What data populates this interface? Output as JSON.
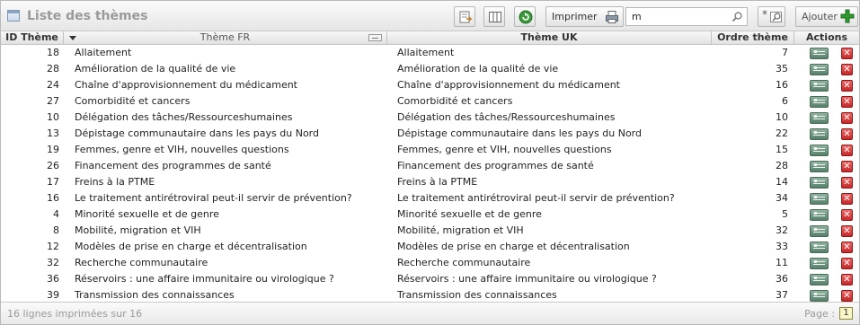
{
  "window": {
    "title": "Liste des thèmes"
  },
  "toolbar": {
    "print_label": "Imprimer",
    "search_value": "m",
    "search_placeholder": "",
    "clear_search_label": "*",
    "add_label": "Ajouter"
  },
  "columns": {
    "id": "ID Thème",
    "fr": "Thème FR",
    "uk": "Thème UK",
    "order": "Ordre thème",
    "actions": "Actions"
  },
  "rows": [
    {
      "id": "18",
      "fr": "Allaitement",
      "uk": "Allaitement",
      "order": "7"
    },
    {
      "id": "28",
      "fr": "Amélioration de la qualité de vie",
      "uk": "Amélioration de la qualité de vie",
      "order": "35"
    },
    {
      "id": "24",
      "fr": "Chaîne d'approvisionnement du médicament",
      "uk": "Chaîne d'approvisionnement du médicament",
      "order": "16"
    },
    {
      "id": "27",
      "fr": "Comorbidité et cancers",
      "uk": "Comorbidité et cancers",
      "order": "6"
    },
    {
      "id": "10",
      "fr": "Délégation des tâches/Ressourceshumaines",
      "uk": "Délégation des tâches/Ressourceshumaines",
      "order": "10"
    },
    {
      "id": "13",
      "fr": "Dépistage communautaire dans les pays du Nord",
      "uk": "Dépistage communautaire dans les pays du Nord",
      "order": "22"
    },
    {
      "id": "19",
      "fr": "Femmes, genre et VIH, nouvelles questions",
      "uk": "Femmes, genre et VIH, nouvelles questions",
      "order": "15"
    },
    {
      "id": "26",
      "fr": "Financement des programmes de santé",
      "uk": "Financement des programmes de santé",
      "order": "28"
    },
    {
      "id": "17",
      "fr": "Freins à la PTME",
      "uk": "Freins à la PTME",
      "order": "14"
    },
    {
      "id": "16",
      "fr": "Le traitement antirétroviral peut-il servir de prévention?",
      "uk": "Le traitement antirétroviral peut-il servir de prévention?",
      "order": "34"
    },
    {
      "id": "4",
      "fr": "Minorité sexuelle et de genre",
      "uk": "Minorité sexuelle et de genre",
      "order": "5"
    },
    {
      "id": "8",
      "fr": "Mobilité, migration et VIH",
      "uk": "Mobilité, migration et VIH",
      "order": "32"
    },
    {
      "id": "12",
      "fr": "Modèles de prise en charge et décentralisation",
      "uk": "Modèles de prise en charge et décentralisation",
      "order": "33"
    },
    {
      "id": "32",
      "fr": "Recherche communautaire",
      "uk": "Recherche communautaire",
      "order": "11"
    },
    {
      "id": "36",
      "fr": "Réservoirs : une affaire immunitaire ou virologique ?",
      "uk": "Réservoirs : une affaire immunitaire ou virologique ?",
      "order": "36"
    },
    {
      "id": "39",
      "fr": "Transmission des connaissances",
      "uk": "Transmission des connaissances",
      "order": "37"
    }
  ],
  "footer": {
    "count_text": "16 lignes imprimées sur 16",
    "page_label": "Page :",
    "page_value": "1"
  },
  "icons": {
    "row_edit": "edit-icon",
    "row_delete": "delete-icon",
    "add": "plus-icon"
  },
  "colors": {
    "add_plus": "#2e9a2e",
    "delete": "#c62828",
    "edit": "#5f8a72"
  }
}
